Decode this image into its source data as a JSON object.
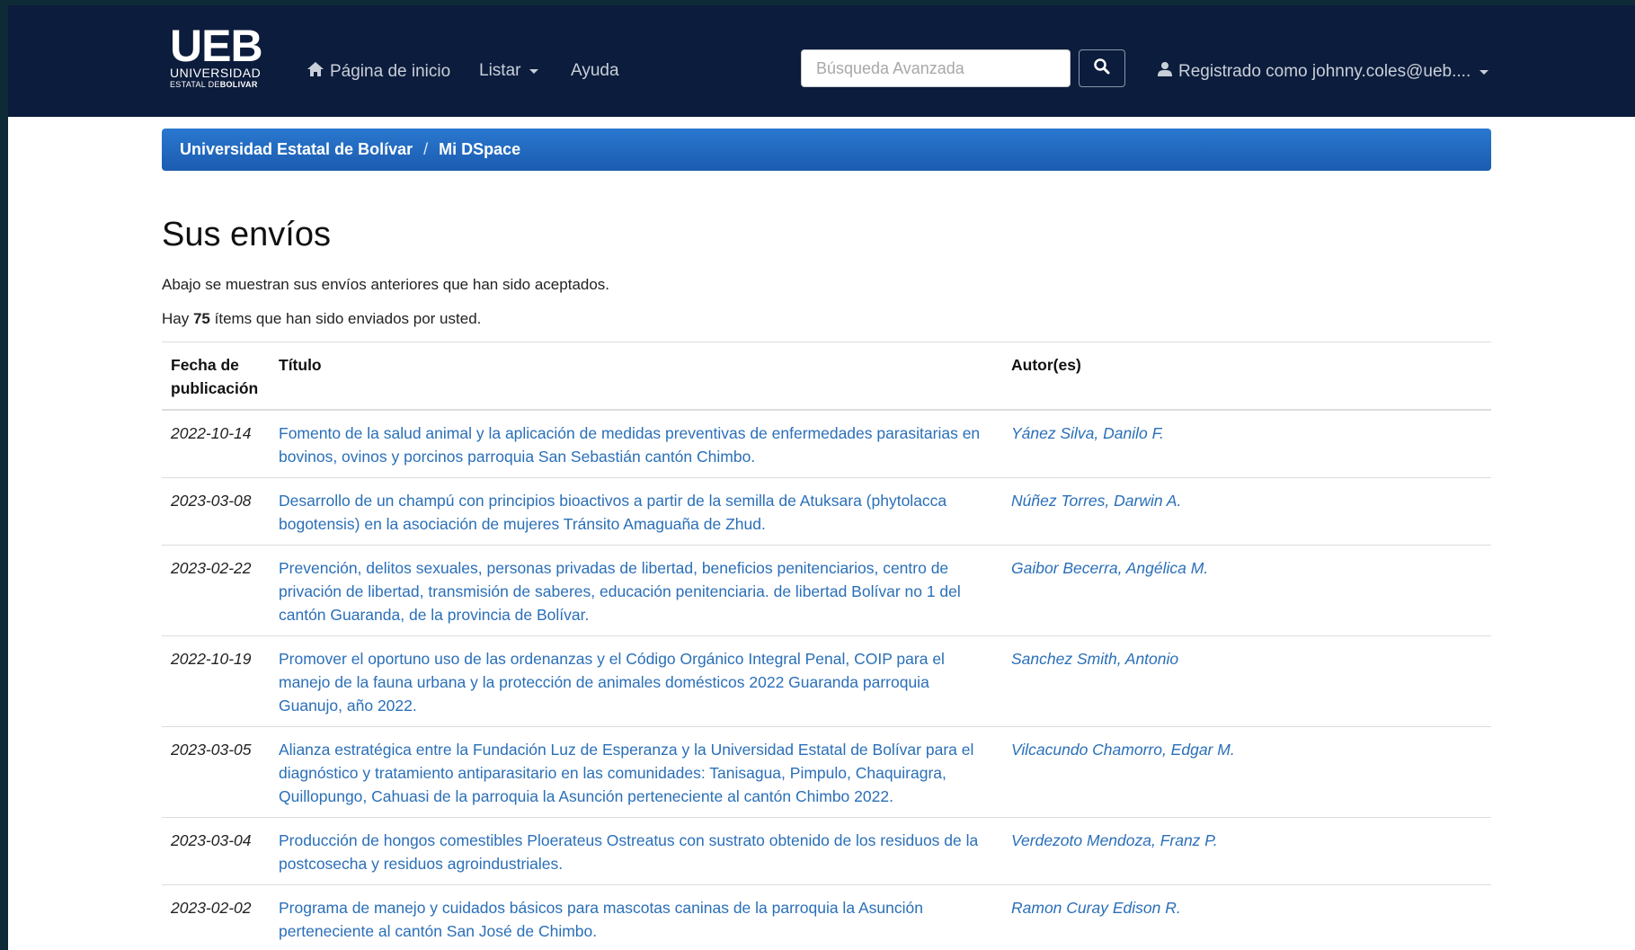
{
  "logo": {
    "big": "UEB",
    "mid": "UNIVERSIDAD",
    "small_a": "ESTATAL DE",
    "small_b": "BOLIVAR"
  },
  "nav": {
    "home_label": "Página de inicio",
    "list_label": "Listar",
    "help_label": "Ayuda",
    "search_placeholder": "Búsqueda Avanzada",
    "user_label": "Registrado como johnny.coles@ueb...."
  },
  "breadcrumb": {
    "root": "Universidad Estatal de Bolívar",
    "separator": "/",
    "current": "Mi DSpace"
  },
  "page": {
    "title": "Sus envíos",
    "intro": "Abajo se muestran sus envíos anteriores que han sido aceptados.",
    "count_prefix": "Hay",
    "count_value": "75",
    "count_suffix": "ítems que han sido enviados por usted."
  },
  "table": {
    "headers": {
      "date_line1": "Fecha de",
      "date_line2": "publicación",
      "title": "Título",
      "authors": "Autor(es)"
    },
    "rows": [
      {
        "date": "2022-10-14",
        "title": "Fomento de la salud animal y la aplicación de medidas preventivas de enfermedades parasitarias en bovinos, ovinos y porcinos parroquia San Sebastián cantón Chimbo.",
        "author": "Yánez Silva, Danilo F."
      },
      {
        "date": "2023-03-08",
        "title": "Desarrollo de un champú con principios bioactivos a partir de la semilla de Atuksara (phytolacca bogotensis) en la asociación de mujeres Tránsito Amaguaña de Zhud.",
        "author": "Núñez Torres, Darwin A."
      },
      {
        "date": "2023-02-22",
        "title": "Prevención, delitos sexuales, personas privadas de libertad, beneficios penitenciarios, centro de privación de libertad, transmisión de saberes, educación penitenciaria. de libertad Bolívar no 1 del cantón Guaranda, de la provincia de Bolívar.",
        "author": "Gaibor Becerra, Angélica M."
      },
      {
        "date": "2022-10-19",
        "title": "Promover el oportuno uso de las ordenanzas y el Código Orgánico Integral Penal, COIP para el manejo de la fauna urbana y la protección de animales domésticos 2022 Guaranda parroquia Guanujo, año 2022.",
        "author": "Sanchez Smith, Antonio"
      },
      {
        "date": "2023-03-05",
        "title": "Alianza estratégica entre la Fundación Luz de Esperanza y la Universidad Estatal de Bolívar para el diagnóstico y tratamiento antiparasitario en las comunidades: Tanisagua, Pimpulo, Chaquiragra, Quillopungo, Cahuasi de la parroquia la Asunción perteneciente al cantón Chimbo 2022.",
        "author": "Vilcacundo Chamorro, Edgar M."
      },
      {
        "date": "2023-03-04",
        "title": "Producción de hongos comestibles Ploerateus Ostreatus con sustrato obtenido de los residuos de la postcosecha y residuos agroindustriales.",
        "author": "Verdezoto Mendoza, Franz P."
      },
      {
        "date": "2023-02-02",
        "title": "Programa de manejo y cuidados básicos para mascotas caninas de la parroquia la Asunción perteneciente al cantón San José de Chimbo.",
        "author": "Ramon Curay Edison R."
      }
    ]
  },
  "colors": {
    "navbar": "#0c1c3c",
    "breadcrumb": "#1f66bf",
    "link": "#2a6fb8"
  }
}
